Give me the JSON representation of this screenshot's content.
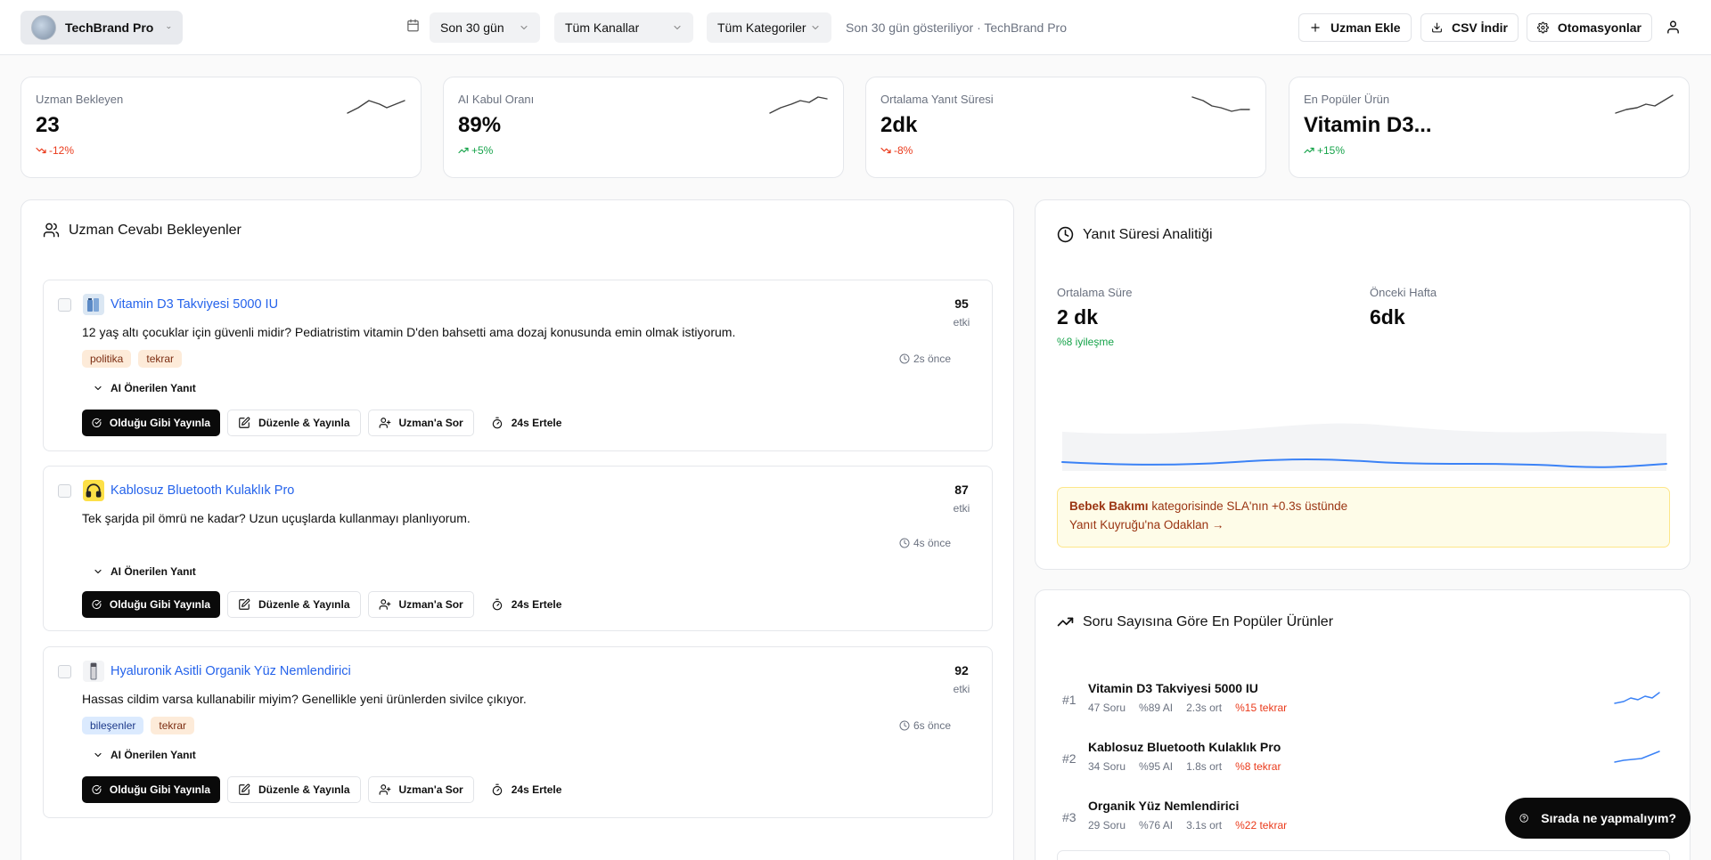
{
  "header": {
    "brand": "TechBrand Pro",
    "filters": {
      "date": "Son 30 gün",
      "channels": "Tüm Kanallar",
      "categories": "Tüm Kategoriler"
    },
    "status": "Son 30 gün gösteriliyor · TechBrand Pro",
    "buttons": {
      "add_expert": "Uzman Ekle",
      "csv": "CSV İndir",
      "automations": "Otomasyonlar"
    }
  },
  "kpis": [
    {
      "title": "Uzman Bekleyen",
      "value": "23",
      "delta": "-12%",
      "trend": "down"
    },
    {
      "title": "AI Kabul Oranı",
      "value": "89%",
      "delta": "+5%",
      "trend": "up"
    },
    {
      "title": "Ortalama Yanıt Süresi",
      "value": "2dk",
      "delta": "-8%",
      "trend": "down"
    },
    {
      "title": "En Popüler Ürün",
      "value": "Vitamin D3...",
      "delta": "+15%",
      "trend": "up"
    }
  ],
  "queue": {
    "title": "Uzman Cevabı Bekleyenler",
    "score_unit": "etki",
    "ai_toggle": "AI Önerilen Yanıt",
    "actions": {
      "publish": "Olduğu Gibi Yayınla",
      "edit": "Düzenle & Yayınla",
      "ask": "Uzman'a Sor",
      "snooze": "24s Ertele"
    },
    "items": [
      {
        "product": "Vitamin D3 Takviyesi 5000 IU",
        "question": "12 yaş altı çocuklar için güvenli midir? Pediatristim vitamin D'den bahsetti ama dozaj konusunda emin olmak istiyorum.",
        "tags": [
          "politika",
          "tekrar"
        ],
        "time": "2s önce",
        "score": "95"
      },
      {
        "product": "Kablosuz Bluetooth Kulaklık Pro",
        "question": "Tek şarjda pil ömrü ne kadar? Uzun uçuşlarda kullanmayı planlıyorum.",
        "tags": [],
        "time": "4s önce",
        "score": "87"
      },
      {
        "product": "Hyaluronik Asitli Organik Yüz Nemlendirici",
        "question": "Hassas cildim varsa kullanabilir miyim? Genellikle yeni ürünlerden sivilce çıkıyor.",
        "tags": [
          "bileşenler",
          "tekrar"
        ],
        "time": "6s önce",
        "score": "92"
      }
    ]
  },
  "analytics": {
    "title": "Yanıt Süresi Analitiği",
    "avg_label": "Ortalama Süre",
    "avg_value": "2 dk",
    "improvement": "%8 iyileşme",
    "prev_label": "Önceki Hafta",
    "prev_value": "6dk",
    "sla": {
      "category": "Bebek Bakımı",
      "text": "kategorisinde SLA'nın +0.3s üstünde",
      "link": "Yanıt Kuyruğu'na Odaklan →"
    }
  },
  "products": {
    "title": "Soru Sayısına Göre En Popüler Ürünler",
    "items": [
      {
        "rank": "#1",
        "name": "Vitamin D3 Takviyesi 5000 IU",
        "questions": "47 Soru",
        "ai": "%89 AI",
        "avg": "2.3s ort",
        "repeat": "%15 tekrar"
      },
      {
        "rank": "#2",
        "name": "Kablosuz Bluetooth Kulaklık Pro",
        "questions": "34 Soru",
        "ai": "%95 AI",
        "avg": "1.8s ort",
        "repeat": "%8 tekrar"
      },
      {
        "rank": "#3",
        "name": "Organik Yüz Nemlendirici",
        "questions": "29 Soru",
        "ai": "%76 AI",
        "avg": "3.1s ort",
        "repeat": "%22 tekrar"
      }
    ]
  },
  "help": {
    "label": "Sırada ne yapmalıyım?"
  },
  "colors": {
    "accent_link": "#2563eb",
    "positive": "#16a34a",
    "negative": "#ea3a1b",
    "primary_button": "#0a0a0a"
  }
}
